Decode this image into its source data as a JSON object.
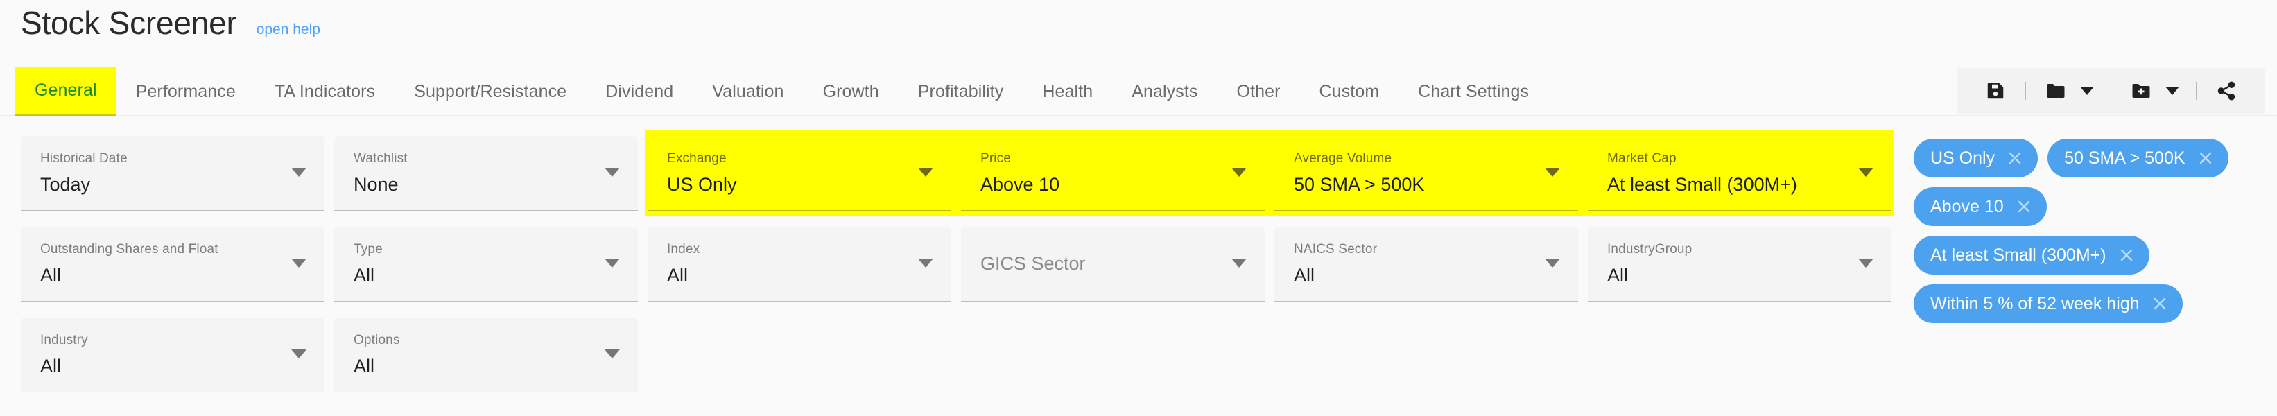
{
  "header": {
    "title": "Stock Screener",
    "help_link": "open help"
  },
  "tabs": [
    {
      "label": "General",
      "active": true
    },
    {
      "label": "Performance",
      "active": false
    },
    {
      "label": "TA Indicators",
      "active": false
    },
    {
      "label": "Support/Resistance",
      "active": false
    },
    {
      "label": "Dividend",
      "active": false
    },
    {
      "label": "Valuation",
      "active": false
    },
    {
      "label": "Growth",
      "active": false
    },
    {
      "label": "Profitability",
      "active": false
    },
    {
      "label": "Health",
      "active": false
    },
    {
      "label": "Analysts",
      "active": false
    },
    {
      "label": "Other",
      "active": false
    },
    {
      "label": "Custom",
      "active": false
    },
    {
      "label": "Chart Settings",
      "active": false
    }
  ],
  "toolbar": {
    "save_icon": "floppy-disk-save-icon",
    "open_icon": "folder-open-icon",
    "open_caret": "chevron-down-icon",
    "new_icon": "folder-plus-new-icon",
    "new_caret": "chevron-down-icon",
    "share_icon": "share-icon"
  },
  "filters": {
    "rows": [
      [
        {
          "label": "Historical Date",
          "value": "Today",
          "highlight": false,
          "placeholder": null
        },
        {
          "label": "Watchlist",
          "value": "None",
          "highlight": false,
          "placeholder": null
        },
        {
          "label": "Exchange",
          "value": "US Only",
          "highlight": true,
          "placeholder": null
        },
        {
          "label": "Price",
          "value": "Above 10",
          "highlight": true,
          "placeholder": null
        },
        {
          "label": "Average Volume",
          "value": "50 SMA > 500K",
          "highlight": true,
          "placeholder": null
        },
        {
          "label": "Market Cap",
          "value": "At least Small (300M+)",
          "highlight": true,
          "placeholder": null
        }
      ],
      [
        {
          "label": "Outstanding Shares and Float",
          "value": "All",
          "highlight": false,
          "placeholder": null
        },
        {
          "label": "Type",
          "value": "All",
          "highlight": false,
          "placeholder": null
        },
        {
          "label": "Index",
          "value": "All",
          "highlight": false,
          "placeholder": null
        },
        {
          "label": null,
          "value": null,
          "highlight": false,
          "placeholder": "GICS Sector"
        },
        {
          "label": "NAICS Sector",
          "value": "All",
          "highlight": false,
          "placeholder": null
        },
        {
          "label": "IndustryGroup",
          "value": "All",
          "highlight": false,
          "placeholder": null
        }
      ],
      [
        {
          "label": "Industry",
          "value": "All",
          "highlight": false,
          "placeholder": null
        },
        {
          "label": "Options",
          "value": "All",
          "highlight": false,
          "placeholder": null
        }
      ]
    ]
  },
  "active_filter_chips": [
    {
      "label": "US Only"
    },
    {
      "label": "50 SMA > 500K"
    },
    {
      "label": "Above 10"
    },
    {
      "label": "At least Small (300M+)"
    },
    {
      "label": "Within 5 % of 52 week high"
    }
  ],
  "colors": {
    "page_background": "#fafafa",
    "highlight_yellow": "#ffff00",
    "active_tab_text": "#1d8a27",
    "chip_blue": "#4da2f0",
    "link_blue": "#4ea2f5",
    "field_background": "#f4f4f4"
  }
}
